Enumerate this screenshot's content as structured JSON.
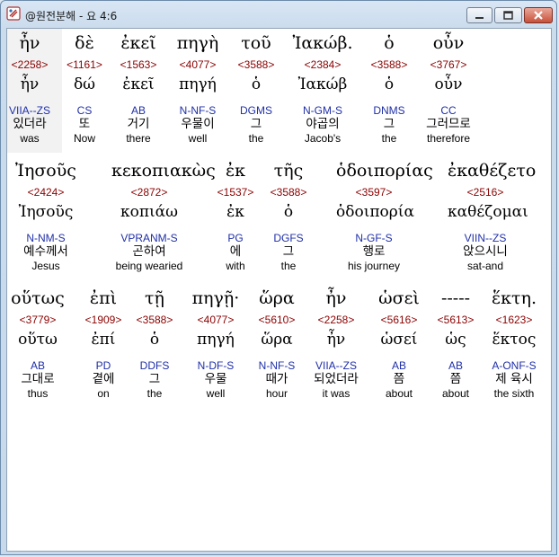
{
  "window": {
    "title": "@원전분해 - 요 4:6"
  },
  "rows": [
    {
      "words": [
        {
          "greek": "ἦν",
          "strong": "<2258>",
          "lemma": "ἦν",
          "parse": "VIIA--ZS",
          "korean": "있더라",
          "english": "was"
        },
        {
          "greek": "δὲ",
          "strong": "<1161>",
          "lemma": "δώ",
          "parse": "CS",
          "korean": "또",
          "english": "Now"
        },
        {
          "greek": "ἐκεῖ",
          "strong": "<1563>",
          "lemma": "ἐκεῖ",
          "parse": "AB",
          "korean": "거기",
          "english": "there"
        },
        {
          "greek": "πηγὴ",
          "strong": "<4077>",
          "lemma": "πηγή",
          "parse": "N-NF-S",
          "korean": "우물이",
          "english": "well"
        },
        {
          "greek": "τοῦ",
          "strong": "<3588>",
          "lemma": "ὁ",
          "parse": "DGMS",
          "korean": "그",
          "english": "the"
        },
        {
          "greek": "Ἰακώβ.",
          "strong": "<2384>",
          "lemma": "Ἰακώβ",
          "parse": "N-GM-S",
          "korean": "야곱의",
          "english": "Jacob's"
        },
        {
          "greek": "ὁ",
          "strong": "<3588>",
          "lemma": "ὁ",
          "parse": "DNMS",
          "korean": "그",
          "english": "the"
        },
        {
          "greek": "οὖν",
          "strong": "<3767>",
          "lemma": "οὖν",
          "parse": "CC",
          "korean": "그러므로",
          "english": "therefore"
        }
      ]
    },
    {
      "words": [
        {
          "greek": "Ἰησοῦς",
          "strong": "<2424>",
          "lemma": "Ἰησοῦς",
          "parse": "N-NM-S",
          "korean": "예수께서",
          "english": "Jesus"
        },
        {
          "greek": "κεκοπιακὼς",
          "strong": "<2872>",
          "lemma": "κοπιάω",
          "parse": "VPRANM-S",
          "korean": "곤하여",
          "english": "being wearied"
        },
        {
          "greek": "ἐκ",
          "strong": "<1537>",
          "lemma": "ἐκ",
          "parse": "PG",
          "korean": "에",
          "english": "with"
        },
        {
          "greek": "τῆς",
          "strong": "<3588>",
          "lemma": "ὁ",
          "parse": "DGFS",
          "korean": "그",
          "english": "the"
        },
        {
          "greek": "ὁδοιπορίας",
          "strong": "<3597>",
          "lemma": "ὁδοιπορία",
          "parse": "N-GF-S",
          "korean": "행로",
          "english": "his journey"
        },
        {
          "greek": "ἐκαθέζετο",
          "strong": "<2516>",
          "lemma": "καθέζομαι",
          "parse": "VIIN--ZS",
          "korean": "앉으시니",
          "english": "sat-and"
        }
      ]
    },
    {
      "words": [
        {
          "greek": "οὕτως",
          "strong": "<3779>",
          "lemma": "οὕτω",
          "parse": "AB",
          "korean": "그대로",
          "english": "thus"
        },
        {
          "greek": "ἐπὶ",
          "strong": "<1909>",
          "lemma": "ἐπί",
          "parse": "PD",
          "korean": "곁에",
          "english": "on"
        },
        {
          "greek": "τῇ",
          "strong": "<3588>",
          "lemma": "ὁ",
          "parse": "DDFS",
          "korean": "그",
          "english": "the"
        },
        {
          "greek": "πηγῇ·",
          "strong": "<4077>",
          "lemma": "πηγή",
          "parse": "N-DF-S",
          "korean": "우물",
          "english": "well"
        },
        {
          "greek": "ὥρα",
          "strong": "<5610>",
          "lemma": "ὥρα",
          "parse": "N-NF-S",
          "korean": "때가",
          "english": "hour"
        },
        {
          "greek": "ἦν",
          "strong": "<2258>",
          "lemma": "ἦν",
          "parse": "VIIA--ZS",
          "korean": "되었더라",
          "english": "it was"
        },
        {
          "greek": "ὡσεὶ",
          "strong": "<5616>",
          "lemma": "ὡσεί",
          "parse": "AB",
          "korean": "쯤",
          "english": "about"
        },
        {
          "greek": "-----",
          "strong": "<5613>",
          "lemma": "ὡς",
          "parse": "AB",
          "korean": "쯤",
          "english": "about"
        },
        {
          "greek": "ἕκτη.",
          "strong": "<1623>",
          "lemma": "ἕκτος",
          "parse": "A-ONF-S",
          "korean": "제 육시",
          "english": "the sixth"
        }
      ]
    }
  ]
}
